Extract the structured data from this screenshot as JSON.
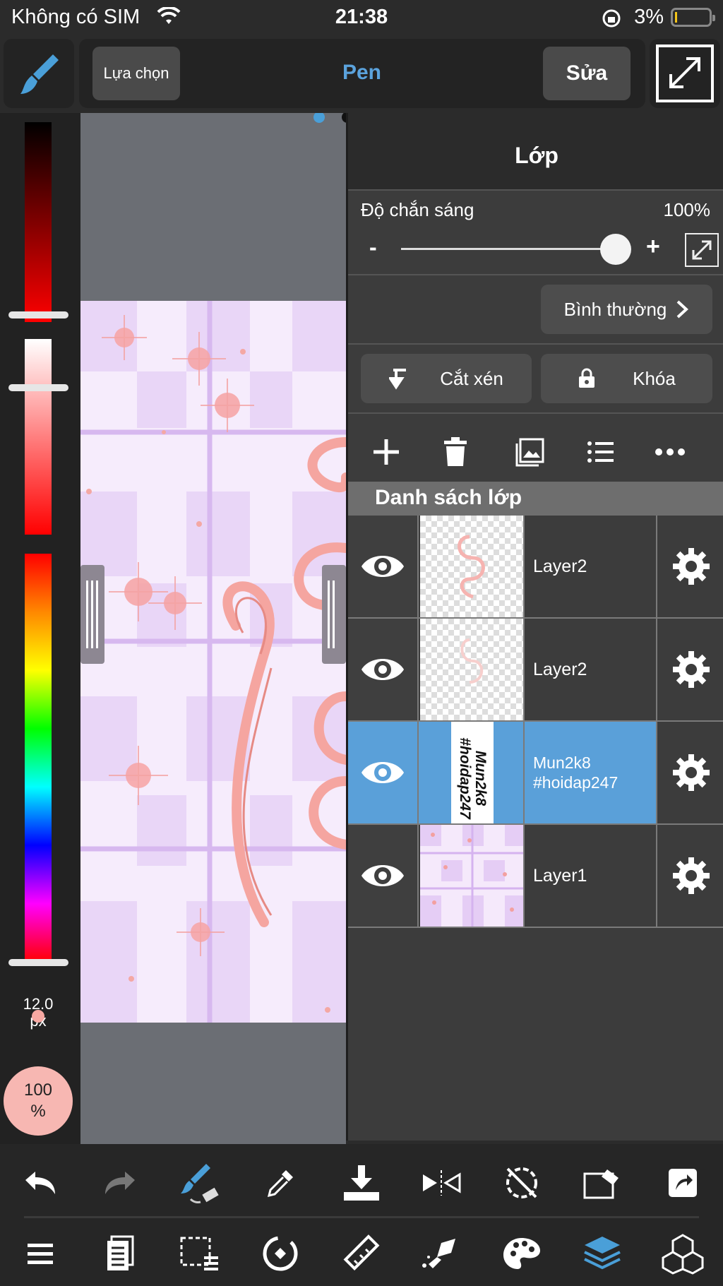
{
  "status": {
    "carrier": "Không có SIM",
    "time": "21:38",
    "battery": "3%"
  },
  "toolbar": {
    "selection_label": "Lựa chọn",
    "tool_title": "Pen",
    "edit_label": "Sửa"
  },
  "left_panel": {
    "brush_size": "12.0",
    "brush_unit": "px",
    "opacity": "100",
    "opacity_unit": "%"
  },
  "layer_panel": {
    "title": "Lớp",
    "opacity_label": "Độ chắn sáng",
    "opacity_value": "100%",
    "opacity_level": 1.0,
    "minus": "-",
    "plus": "+",
    "blend_mode": "Bình thường",
    "clip_label": "Cắt xén",
    "lock_label": "Khóa",
    "list_title": "Danh sách lớp",
    "layers": [
      {
        "name": "Layer2",
        "visible": true,
        "selected": false
      },
      {
        "name": "Layer2",
        "visible": true,
        "selected": false
      },
      {
        "name": "Mun2k8\n#hoidap247",
        "visible": true,
        "selected": true,
        "thumb_text_1": "Mun2k8",
        "thumb_text_2": "#hoidap247"
      },
      {
        "name": "Layer1",
        "visible": true,
        "selected": false
      }
    ]
  },
  "colors": {
    "accent": "#5ba3dd",
    "selected_layer": "#5aa0d9",
    "panel": "#3c3c3c",
    "opacity_circle": "#f7b7b2"
  },
  "icons": {
    "bottom_row1": [
      "undo-icon",
      "redo-icon",
      "brush-eraser-swap-icon",
      "eyedropper-icon",
      "save-download-icon",
      "flip-horizontal-icon",
      "rotate-reset-icon",
      "transform-icon",
      "share-icon"
    ],
    "bottom_row2": [
      "menu-icon",
      "pages-icon",
      "selection-icon",
      "snap-icon",
      "ruler-icon",
      "fill-icon",
      "palette-icon",
      "layers-icon",
      "materials-icon"
    ]
  }
}
